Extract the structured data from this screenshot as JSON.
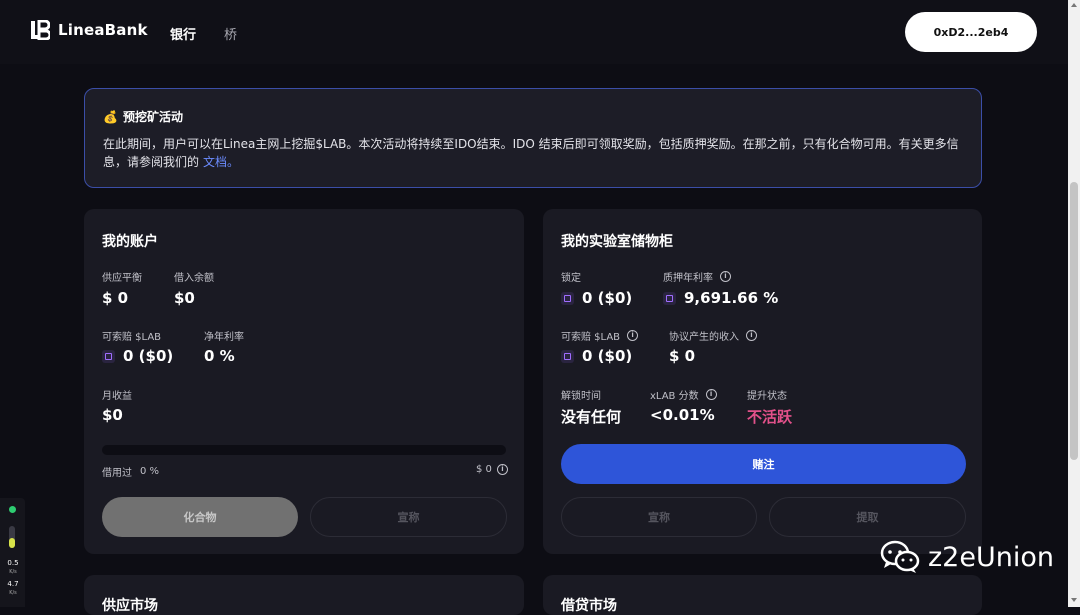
{
  "nav": {
    "brand": "LineaBank",
    "links": [
      "银行",
      "桥"
    ],
    "wallet": "0xD2...2eb4"
  },
  "banner": {
    "title": "预挖矿活动",
    "text": "在此期间，用户可以在Linea主网上挖掘$LAB。本次活动将持续至IDO结束。IDO 结束后即可领取奖励，包括质押奖励。在那之前，只有化合物可用。有关更多信息，请参阅我们的",
    "link": "文档。"
  },
  "account": {
    "title": "我的账户",
    "supply_label": "供应平衡",
    "supply_value": "$ 0",
    "borrow_label": "借入余额",
    "borrow_value": "$0",
    "claimable_label": "可索赔 $LAB",
    "claimable_value": "0 ($0)",
    "net_apr_label": "净年利率",
    "net_apr_value": "0 %",
    "monthly_label": "月收益",
    "monthly_value": "$0",
    "credit_used_label": "借用过",
    "credit_used_value": "0 %",
    "credit_used_fraction": 0,
    "credit_limit_value": "$ 0",
    "compound_button": "化合物",
    "claim_button": "宣称"
  },
  "locker": {
    "title": "我的实验室储物柜",
    "locked_label": "锁定",
    "locked_value": "0 ($0)",
    "stake_apr_label": "质押年利率",
    "stake_apr_value": "9,691.66 %",
    "claimable_label": "可索赔 $LAB",
    "claimable_value": "0 ($0)",
    "protocol_income_label": "协议产生的收入",
    "protocol_income_value": "$ 0",
    "unlock_label": "解锁时间",
    "unlock_value": "没有任何",
    "xlab_label": "xLAB 分数",
    "xlab_value": "<0.01%",
    "boost_label": "提升状态",
    "boost_value": "不活跃",
    "stake_button": "赌注",
    "claim_button": "宣称",
    "withdraw_button": "提取"
  },
  "sections": {
    "supply_market": "供应市场",
    "borrow_market": "借贷市场"
  },
  "side_widget": {
    "up_value": "0.5",
    "up_unit": "K/s",
    "down_value": "4.7",
    "down_unit": "K/s"
  },
  "watermark": "z2eUnion",
  "colors": {
    "accent_blue": "#2e55d9",
    "link": "#6c8cff",
    "inactive_pink": "#e2518a",
    "banner_border": "#3b4ea8"
  }
}
